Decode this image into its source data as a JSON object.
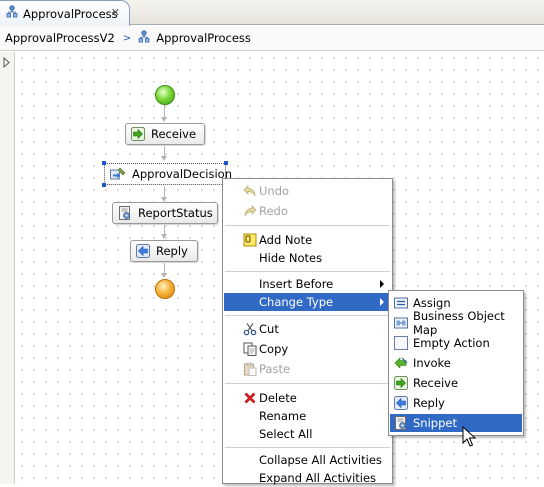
{
  "editor_tab": {
    "label": "ApprovalProcess",
    "close_glyph": "✕",
    "icon": "process-icon"
  },
  "breadcrumb": {
    "items": [
      "ApprovalProcessV2",
      "ApprovalProcess"
    ],
    "separator": ">"
  },
  "diagram": {
    "nodes": [
      {
        "label": "Receive",
        "icon": "receive-icon"
      },
      {
        "label": "ApprovalDecision",
        "icon": "decision-icon"
      },
      {
        "label": "ReportStatus",
        "icon": "snippet-icon"
      },
      {
        "label": "Reply",
        "icon": "reply-icon"
      }
    ]
  },
  "context_menu": {
    "undo": "Undo",
    "redo": "Redo",
    "add_note": "Add Note",
    "hide_notes": "Hide Notes",
    "insert_before": "Insert Before",
    "change_type": "Change Type",
    "cut": "Cut",
    "copy": "Copy",
    "paste": "Paste",
    "delete": "Delete",
    "rename": "Rename",
    "select_all": "Select All",
    "collapse_all": "Collapse All Activities",
    "expand_all": "Expand All Activities"
  },
  "change_type_submenu": {
    "items": [
      "Assign",
      "Business Object Map",
      "Empty Action",
      "Invoke",
      "Receive",
      "Reply",
      "Snippet"
    ],
    "selected": "Snippet"
  },
  "colors": {
    "selection": "#316ac5",
    "start_event": "#4cb317",
    "end_event": "#f0a020",
    "handle": "#1c55c7"
  }
}
